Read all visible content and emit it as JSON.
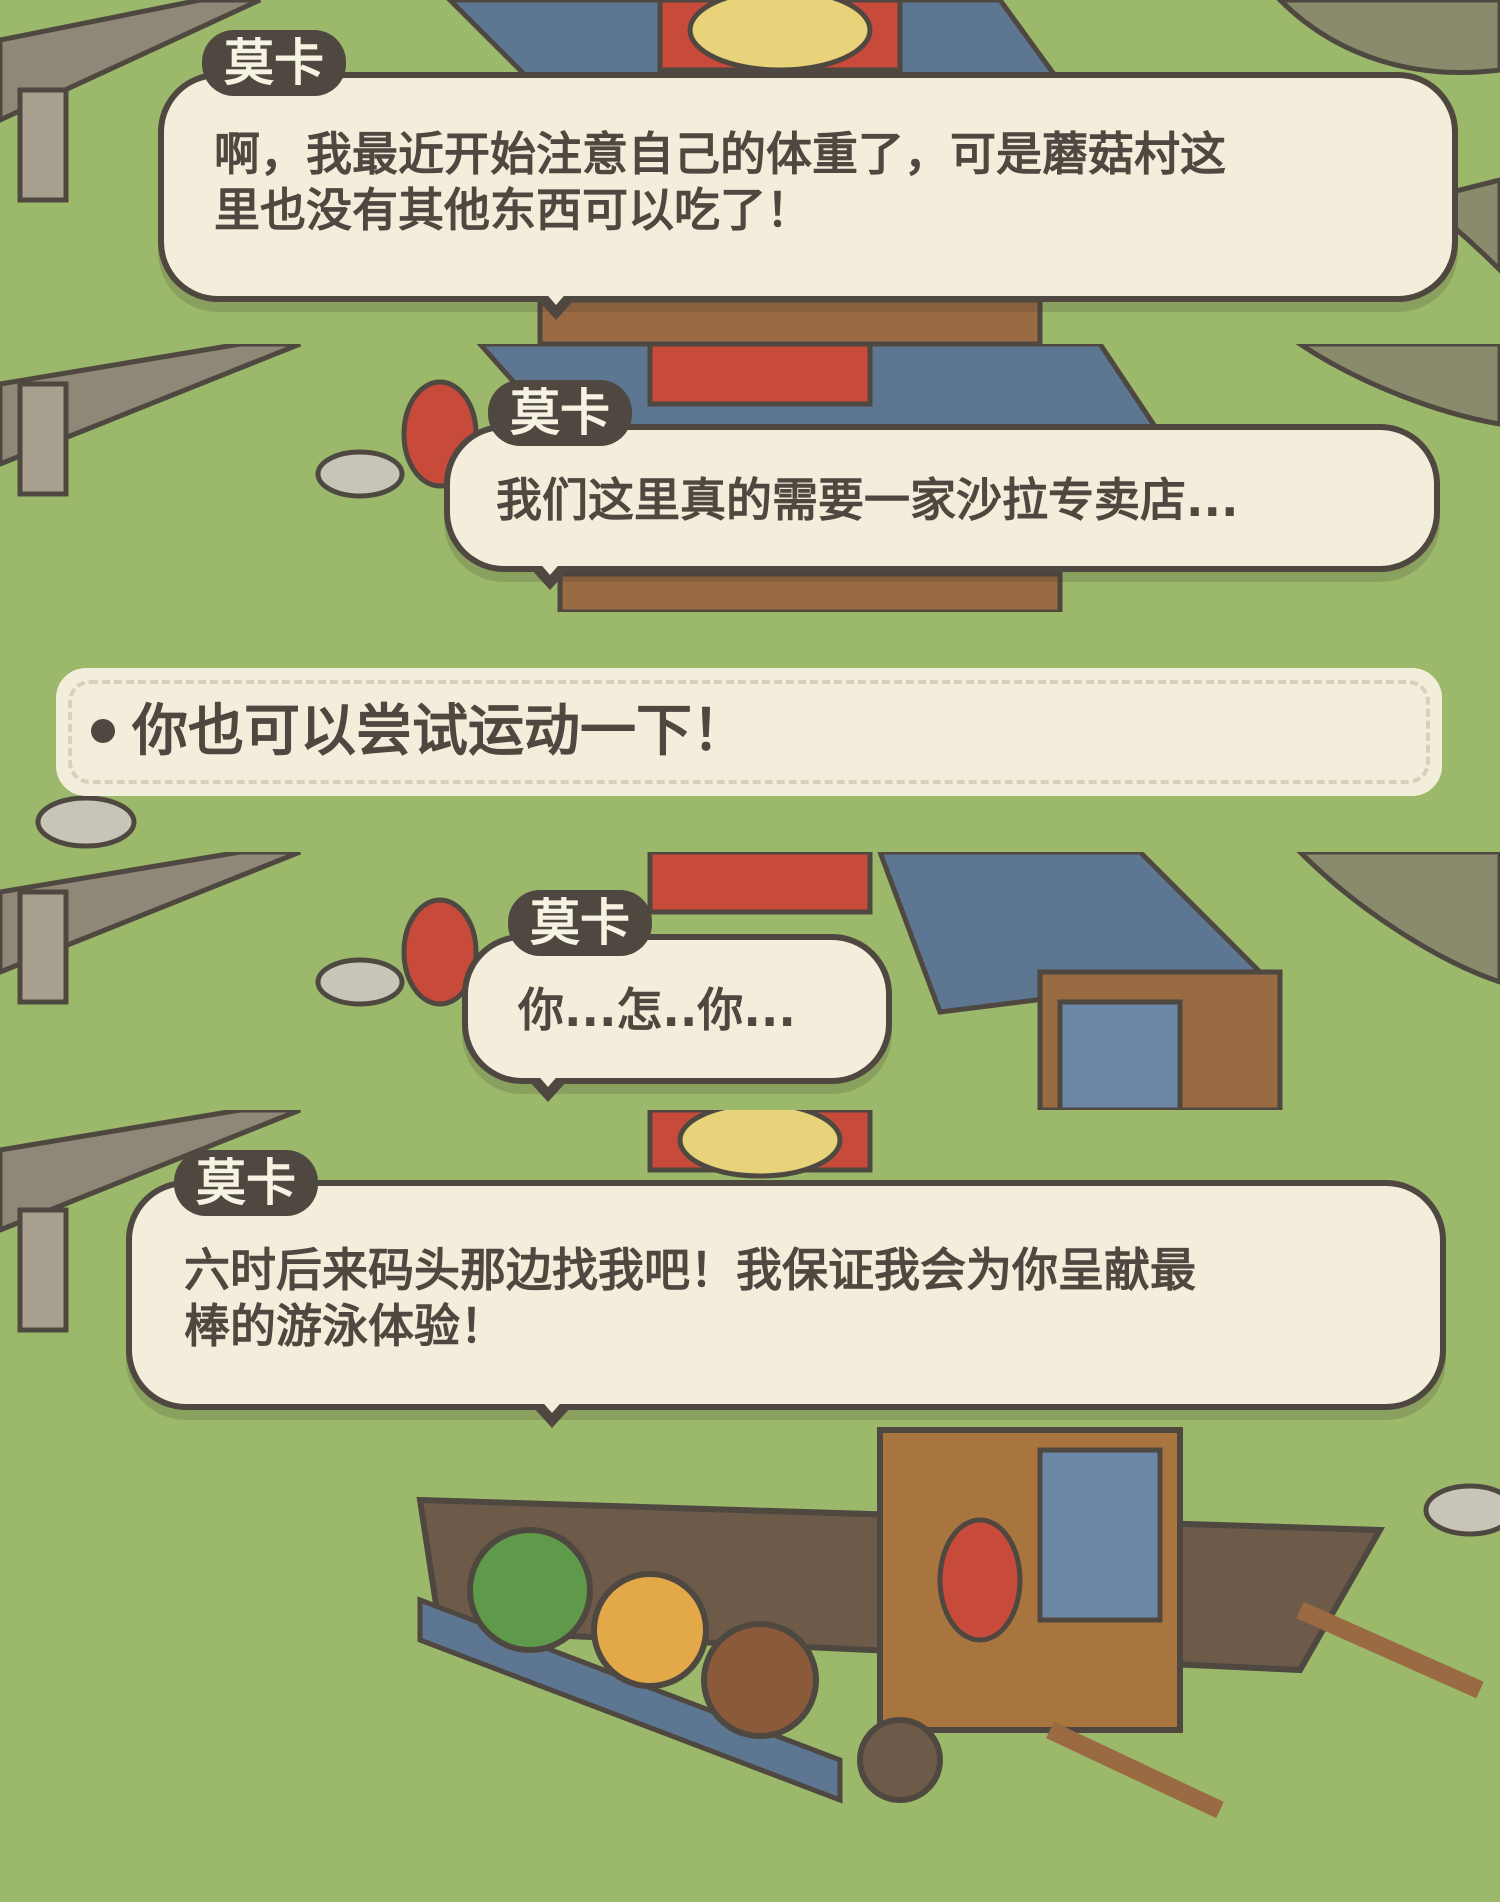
{
  "dialogs": [
    {
      "speaker": "莫卡",
      "lines": [
        "啊，我最近开始注意自己的体重了，可是蘑菇村这",
        "里也没有其他东西可以吃了！"
      ]
    },
    {
      "speaker": "莫卡",
      "lines": [
        "我们这里真的需要一家沙拉专卖店..."
      ]
    },
    {
      "speaker": "莫卡",
      "lines": [
        "你...怎..你..."
      ]
    },
    {
      "speaker": "莫卡",
      "lines": [
        "六时后来码头那边找我吧！我保证我会为你呈献最",
        "棒的游泳体验！"
      ]
    }
  ],
  "choice": {
    "label": "你也可以尝试运动一下！"
  },
  "colors": {
    "grass": "#9cb86a",
    "bubble_fill": "#f2eedb",
    "ink": "#4e4840",
    "roof": "#5d7691",
    "wood": "#9a6a42"
  }
}
